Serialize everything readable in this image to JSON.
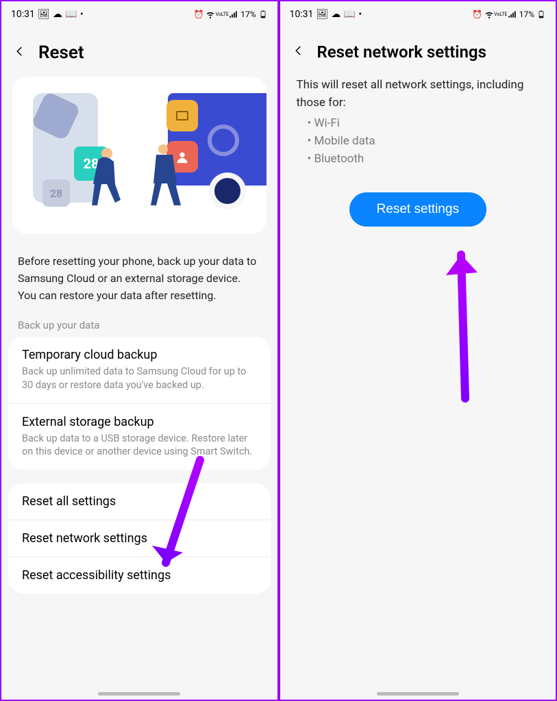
{
  "statusbar": {
    "time": "10:31",
    "battery_text": "17%"
  },
  "left": {
    "title": "Reset",
    "intro": "Before resetting your phone, back up your data to Samsung Cloud or an external storage device. You can restore your data after resetting.",
    "section_label": "Back up your data",
    "illustration_cal": "28",
    "illustration_cal_dupe": "28",
    "backup": [
      {
        "title": "Temporary cloud backup",
        "sub": "Back up unlimited data to Samsung Cloud for up to 30 days or restore data you've backed up."
      },
      {
        "title": "External storage backup",
        "sub": "Back up data to a USB storage device. Restore later on this device or another device using Smart Switch."
      }
    ],
    "resets": [
      {
        "title": "Reset all settings"
      },
      {
        "title": "Reset network settings"
      },
      {
        "title": "Reset accessibility settings"
      }
    ]
  },
  "right": {
    "title": "Reset network settings",
    "desc": "This will reset all network settings, including those for:",
    "bullets": [
      "Wi-Fi",
      "Mobile data",
      "Bluetooth"
    ],
    "button": "Reset settings"
  }
}
